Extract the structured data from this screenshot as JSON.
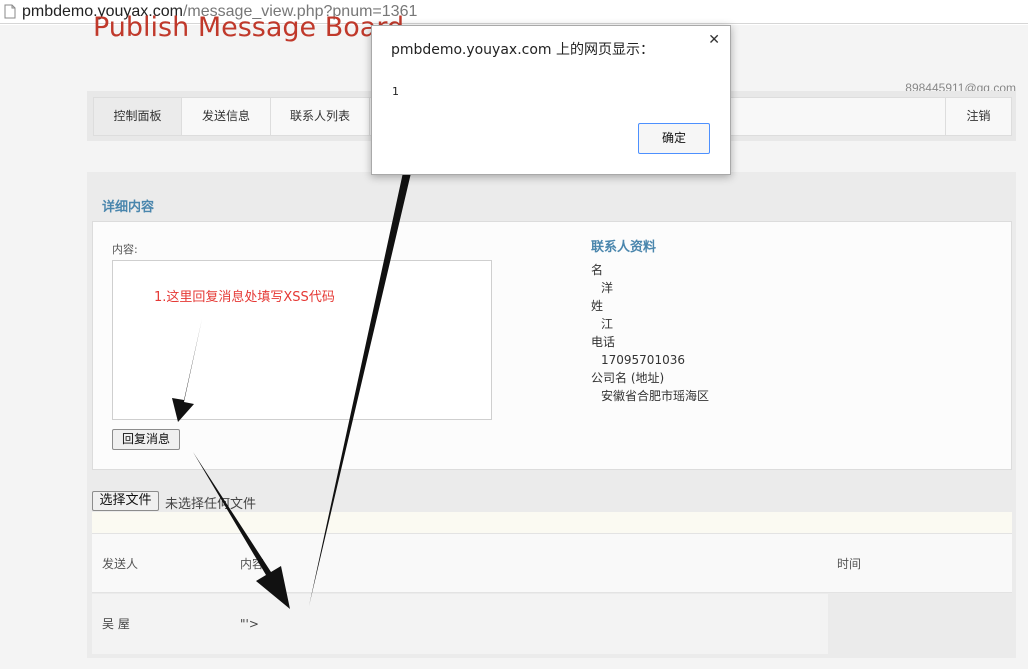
{
  "browser": {
    "url_host": "pmbdemo.youyax.com",
    "url_path": "/message_view.php?pnum=1361",
    "icon": "page-icon"
  },
  "header": {
    "brand": "Publish Message Board",
    "user_email": "898445911@qq.com"
  },
  "nav": {
    "items": [
      "控制面板",
      "发送信息",
      "联系人列表"
    ],
    "logout": "注销"
  },
  "detail": {
    "title": "详细内容",
    "content_label": "内容:",
    "content_value": "",
    "annotation": "1.这里回复消息处填写XSS代码",
    "reply_button": "回复消息"
  },
  "contact": {
    "title": "联系人资料",
    "fields": [
      {
        "label": "名",
        "value": "洋"
      },
      {
        "label": "姓",
        "value": "江"
      },
      {
        "label": "电话",
        "value": "17095701036"
      },
      {
        "label": "公司名 (地址)",
        "value": "安徽省合肥市瑶海区"
      }
    ]
  },
  "upload": {
    "choose_button": "选择文件",
    "status": "未选择任何文件"
  },
  "messages": {
    "columns": [
      "发送人",
      "内容",
      "时间"
    ],
    "rows": [
      {
        "sender": "吴 屋",
        "content": "\"'>",
        "time": ""
      }
    ]
  },
  "alert": {
    "title": "pmbdemo.youyax.com 上的网页显示：",
    "message": "1",
    "ok_button": "确定",
    "close_icon": "close-icon"
  },
  "colors": {
    "brand": "#c0392b",
    "section_title": "#4a86ad",
    "annotation": "#e53935",
    "dialog_button_border": "#4d90fe"
  }
}
